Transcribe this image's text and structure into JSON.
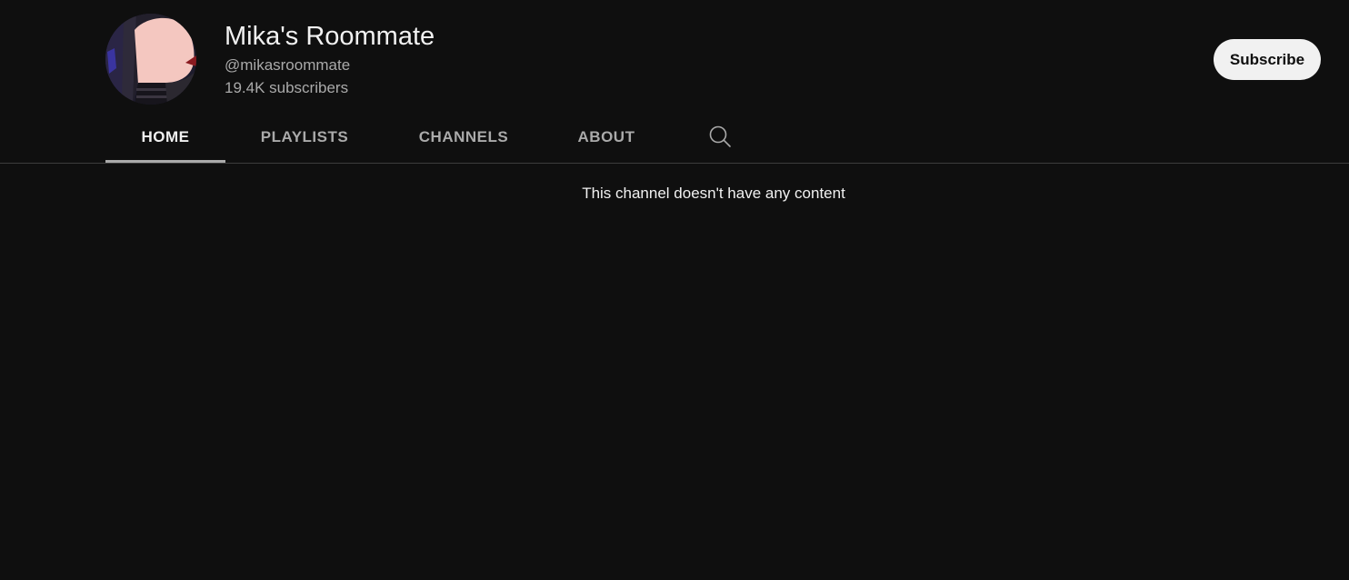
{
  "channel": {
    "title": "Mika's Roommate",
    "handle": "@mikasroommate",
    "subscribers": "19.4K subscribers",
    "avatar_icon": "channel-avatar-image"
  },
  "subscribe": {
    "label": "Subscribe"
  },
  "tabs": [
    {
      "label": "HOME",
      "active": true
    },
    {
      "label": "PLAYLISTS",
      "active": false
    },
    {
      "label": "CHANNELS",
      "active": false
    },
    {
      "label": "ABOUT",
      "active": false
    }
  ],
  "search": {
    "icon": "search-icon"
  },
  "main": {
    "empty_message": "This channel doesn't have any content"
  },
  "colors": {
    "background": "#0f0f0f",
    "text": "#f1f1f1",
    "secondary_text": "#aaaaaa",
    "button_bg": "#f1f1f1",
    "divider": "#3d3d3d"
  }
}
